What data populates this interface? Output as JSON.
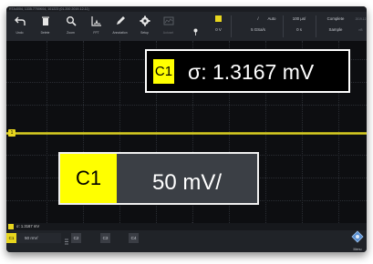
{
  "infobar": {
    "text": "RTA4004, 1335.7700K04, 101223 (01.200 2019-12-11)"
  },
  "toolbar": {
    "buttons": [
      {
        "label": "Undo",
        "icon": "undo-icon"
      },
      {
        "label": "Delete",
        "icon": "trash-icon"
      },
      {
        "label": "Zoom",
        "icon": "magnifier-icon"
      },
      {
        "label": "FFT",
        "icon": "fft-icon"
      },
      {
        "label": "Annotation",
        "icon": "pen-icon"
      },
      {
        "label": "Setup",
        "icon": "gear-icon"
      },
      {
        "label": "Autoset",
        "icon": "autoset-icon"
      }
    ],
    "status": {
      "trigger_level": "0 V",
      "sample_rate": "5 GSa/s",
      "mode": "Auto",
      "timebase": "100 µs/",
      "offset": "0 s",
      "acq_state": "Complete",
      "acq_mode": "Sample",
      "corner_top": "2019-12",
      "corner_bottom": "nB"
    }
  },
  "callouts": {
    "stddev": {
      "channel": "C1",
      "value": "σ: 1.3167 mV"
    },
    "scale": {
      "channel": "C1",
      "value": "50 mV/"
    }
  },
  "measurement": {
    "text": "σ: 1.3167 mV"
  },
  "channels": [
    {
      "tag": "C1",
      "scale": "50 mV/",
      "active": true
    },
    {
      "tag": "C2",
      "active": false
    },
    {
      "tag": "C3",
      "active": false
    },
    {
      "tag": "C4",
      "active": false
    }
  ],
  "menu": {
    "label": "Menu"
  },
  "colors": {
    "channel1": "#e8d61e",
    "callout_yellow": "#ffff00",
    "background": "#101014"
  }
}
